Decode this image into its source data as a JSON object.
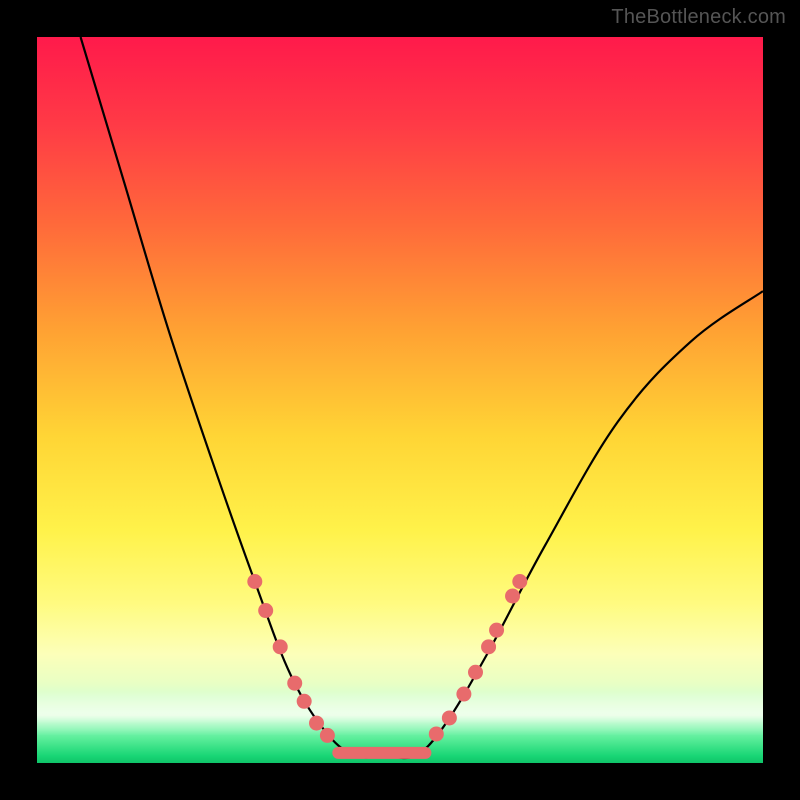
{
  "watermark": "TheBottleneck.com",
  "colors": {
    "dot": "#e86b6c",
    "line": "#000000",
    "background": "#000000"
  },
  "chart_data": {
    "type": "line",
    "title": "",
    "xlabel": "",
    "ylabel": "",
    "xlim": [
      0,
      100
    ],
    "ylim": [
      0,
      100
    ],
    "curve": {
      "description": "asymmetric V-shaped bottleneck curve",
      "points": [
        {
          "x": 6,
          "y": 100
        },
        {
          "x": 12,
          "y": 80
        },
        {
          "x": 18,
          "y": 60
        },
        {
          "x": 24,
          "y": 42
        },
        {
          "x": 30,
          "y": 25
        },
        {
          "x": 35,
          "y": 12
        },
        {
          "x": 40,
          "y": 4
        },
        {
          "x": 44,
          "y": 1
        },
        {
          "x": 48,
          "y": 1
        },
        {
          "x": 52,
          "y": 1
        },
        {
          "x": 56,
          "y": 5
        },
        {
          "x": 62,
          "y": 15
        },
        {
          "x": 70,
          "y": 30
        },
        {
          "x": 80,
          "y": 47
        },
        {
          "x": 90,
          "y": 58
        },
        {
          "x": 100,
          "y": 65
        }
      ]
    },
    "dots_left": [
      {
        "x": 30.0,
        "y": 25
      },
      {
        "x": 31.5,
        "y": 21
      },
      {
        "x": 33.5,
        "y": 16
      },
      {
        "x": 35.5,
        "y": 11
      },
      {
        "x": 36.8,
        "y": 8.5
      },
      {
        "x": 38.5,
        "y": 5.5
      },
      {
        "x": 40.0,
        "y": 3.8
      }
    ],
    "dots_right": [
      {
        "x": 55.0,
        "y": 4.0
      },
      {
        "x": 56.8,
        "y": 6.2
      },
      {
        "x": 58.8,
        "y": 9.5
      },
      {
        "x": 60.4,
        "y": 12.5
      },
      {
        "x": 62.2,
        "y": 16.0
      },
      {
        "x": 63.3,
        "y": 18.3
      },
      {
        "x": 65.5,
        "y": 23.0
      },
      {
        "x": 66.5,
        "y": 25.0
      }
    ],
    "flat_segment": {
      "x1": 41.5,
      "x2": 53.5,
      "y": 1.4,
      "stroke_width_px": 12
    }
  }
}
